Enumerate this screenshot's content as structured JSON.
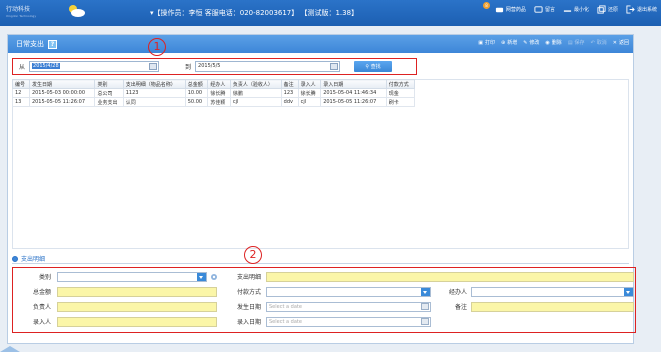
{
  "topbar": {
    "logo_line1": "行动科技",
    "logo_line2": "Xingdon Technology",
    "info": "▾【操作员：李恒  客服电话：020-82003617】 【测试版：1.38】",
    "badge_count": "8",
    "buttons": [
      {
        "label": "网营药品",
        "icon": "pill-icon"
      },
      {
        "label": "留言",
        "icon": "message-icon"
      },
      {
        "label": "最小化",
        "icon": "minimize-icon"
      },
      {
        "label": "还原",
        "icon": "restore-icon"
      },
      {
        "label": "退出系统",
        "icon": "exit-icon"
      }
    ]
  },
  "panel": {
    "title": "日常支出",
    "help": "?",
    "actions": [
      {
        "label": "打印",
        "icon": "print-icon",
        "enabled": true
      },
      {
        "label": "新增",
        "icon": "add-icon",
        "enabled": true
      },
      {
        "label": "修改",
        "icon": "edit-icon",
        "enabled": true
      },
      {
        "label": "删除",
        "icon": "delete-icon",
        "enabled": true
      },
      {
        "label": "保存",
        "icon": "save-icon",
        "enabled": false
      },
      {
        "label": "取消",
        "icon": "cancel-icon",
        "enabled": false
      },
      {
        "label": "返回",
        "icon": "back-icon",
        "enabled": true
      }
    ]
  },
  "annotations": {
    "one": "1",
    "two": "2"
  },
  "search": {
    "from_label": "从",
    "from_value": "2015/4/28",
    "to_label": "到",
    "to_value": "2015/5/5",
    "find_label": "查找"
  },
  "table": {
    "columns": [
      "编号",
      "发生日期",
      "类别",
      "支出明细（物品名称）",
      "总金额",
      "经办人",
      "负责人（验收人）",
      "备注",
      "录入人",
      "录入日期",
      "付款方式"
    ],
    "rows": [
      [
        "12",
        "2015-05-03 00:00:00",
        "总公司",
        "1123",
        "10.00",
        "徐长腾",
        "徐鹏",
        "123",
        "徐长腾",
        "2015-05-04 11:46:34",
        "现金"
      ],
      [
        "13",
        "2015-05-05 11:26:07",
        "业务支出",
        "认同",
        "50.00",
        "苏佳颖",
        "cjl",
        "ddv",
        "cjl",
        "2015-05-05 11:26:07",
        "刷卡"
      ]
    ]
  },
  "detail": {
    "heading": "支出明细",
    "labels": {
      "category": "类别",
      "item": "支出明细",
      "amount": "总金额",
      "payment": "付款方式",
      "handler": "经办人",
      "responsible": "负责人",
      "date": "发生日期",
      "remark": "备注",
      "entered_by": "录入人",
      "entry_date": "录入日期"
    },
    "date_placeholder": "Select a date",
    "entry_date_placeholder": "Select a date"
  }
}
